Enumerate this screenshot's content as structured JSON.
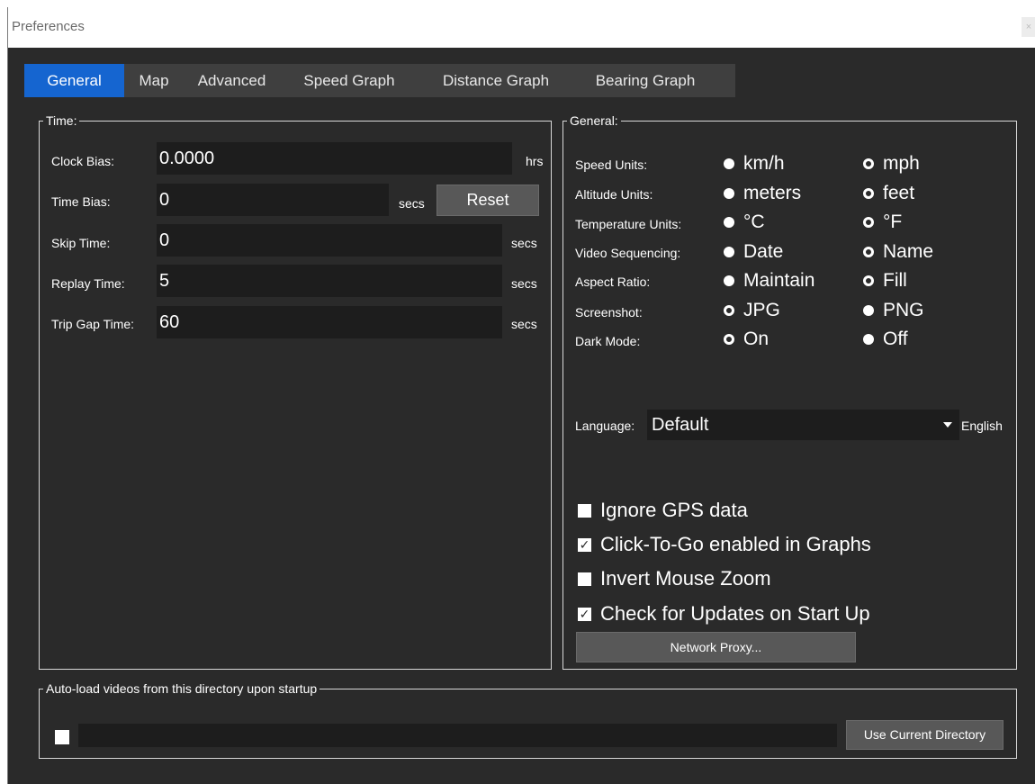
{
  "window": {
    "title": "Preferences",
    "close_label": "×"
  },
  "tabs": [
    {
      "label": "General"
    },
    {
      "label": "Map"
    },
    {
      "label": "Advanced"
    },
    {
      "label": "Speed Graph"
    },
    {
      "label": "Distance Graph"
    },
    {
      "label": "Bearing Graph"
    }
  ],
  "time_group": {
    "legend": "Time:",
    "clock_bias": {
      "label": "Clock Bias:",
      "value": "0.0000",
      "unit": "hrs"
    },
    "time_bias": {
      "label": "Time Bias:",
      "value": "0",
      "unit": "secs",
      "reset_label": "Reset"
    },
    "skip_time": {
      "label": "Skip Time:",
      "value": "0",
      "unit": "secs"
    },
    "replay_time": {
      "label": "Replay Time:",
      "value": "5",
      "unit": "secs"
    },
    "trip_gap_time": {
      "label": "Trip Gap Time:",
      "value": "60",
      "unit": "secs"
    }
  },
  "general_group": {
    "legend": "General:",
    "speed_units": {
      "label": "Speed Units:",
      "opt1": "km/h",
      "opt2": "mph",
      "selected": 1
    },
    "altitude_units": {
      "label": "Altitude Units:",
      "opt1": "meters",
      "opt2": "feet",
      "selected": 1
    },
    "temperature_units": {
      "label": "Temperature Units:",
      "opt1": "°C",
      "opt2": "°F",
      "selected": 1
    },
    "video_sequencing": {
      "label": "Video Sequencing:",
      "opt1": "Date",
      "opt2": "Name",
      "selected": 1
    },
    "aspect_ratio": {
      "label": "Aspect Ratio:",
      "opt1": "Maintain",
      "opt2": "Fill",
      "selected": 1
    },
    "screenshot": {
      "label": "Screenshot:",
      "opt1": "JPG",
      "opt2": "PNG",
      "selected": 2
    },
    "dark_mode": {
      "label": "Dark Mode:",
      "opt1": "On",
      "opt2": "Off",
      "selected": 2
    },
    "language": {
      "label": "Language:",
      "value": "Default",
      "suffix": "English"
    },
    "checkboxes": {
      "ignore_gps": {
        "label": "Ignore GPS data",
        "checked": false
      },
      "click_to_go": {
        "label": "Click-To-Go enabled in Graphs",
        "checked": true
      },
      "invert_zoom": {
        "label": "Invert Mouse Zoom",
        "checked": false
      },
      "check_updates": {
        "label": "Check for Updates on Start Up",
        "checked": true
      }
    },
    "network_proxy_label": "Network Proxy..."
  },
  "autoload_group": {
    "legend": "Auto-load videos from this directory upon startup",
    "path_value": "",
    "checked": false,
    "use_current_label": "Use Current Directory"
  },
  "colors": {
    "window_bg": "#2a2a2a",
    "field_bg": "#1d1d1d",
    "tab_active": "#1565d0",
    "tab_bar": "#3f3f3f",
    "button_bg": "#585858"
  }
}
